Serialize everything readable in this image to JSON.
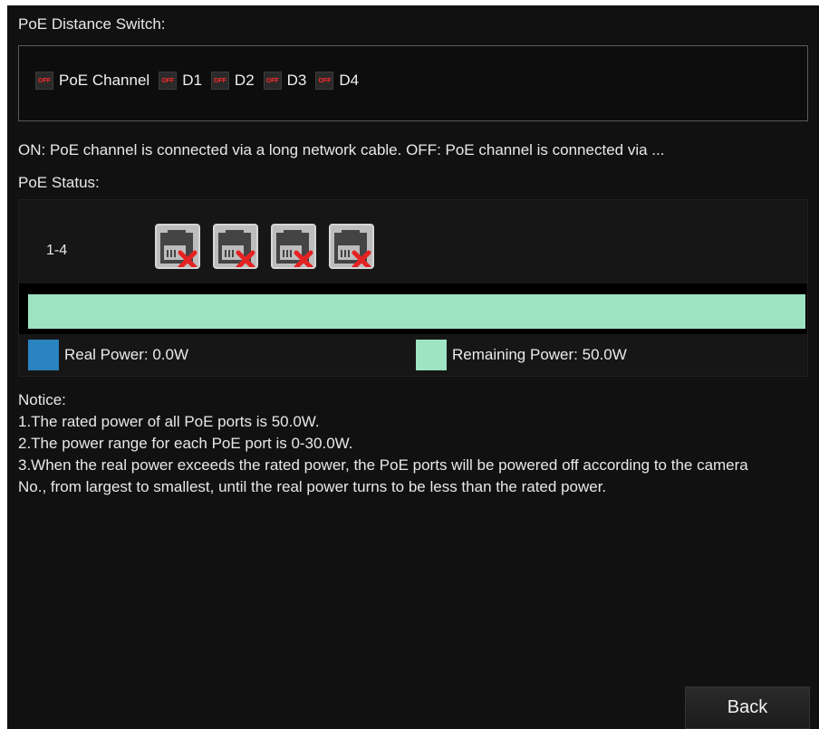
{
  "switch_section": {
    "title": "PoE Distance Switch:",
    "toggles": [
      {
        "state": "OFF",
        "label": "PoE Channel"
      },
      {
        "state": "OFF",
        "label": "D1"
      },
      {
        "state": "OFF",
        "label": "D2"
      },
      {
        "state": "OFF",
        "label": "D3"
      },
      {
        "state": "OFF",
        "label": "D4"
      }
    ],
    "description": "ON: PoE channel is connected via a long network cable. OFF: PoE channel is connected via ..."
  },
  "status_section": {
    "title": "PoE Status:",
    "range_label": "1-4",
    "ports": [
      {
        "icon": "ethernet-port-disconnected-icon"
      },
      {
        "icon": "ethernet-port-disconnected-icon"
      },
      {
        "icon": "ethernet-port-disconnected-icon"
      },
      {
        "icon": "ethernet-port-disconnected-icon"
      }
    ],
    "real_power_label": "Real Power: 0.0W",
    "remaining_power_label": "Remaining Power: 50.0W",
    "real_power_color": "#2b83c0",
    "remaining_power_color": "#9ee3c2",
    "real_power_fraction": 0.0
  },
  "notice": {
    "title": "Notice:",
    "lines": [
      "1.The rated power of all PoE ports is 50.0W.",
      "2.The power range for each PoE port is 0-30.0W.",
      "3.When the real power exceeds the rated power, the PoE ports will be powered off according to the camera No., from largest to smallest, until the real power turns to be less than the rated power."
    ]
  },
  "footer": {
    "back_label": "Back"
  }
}
